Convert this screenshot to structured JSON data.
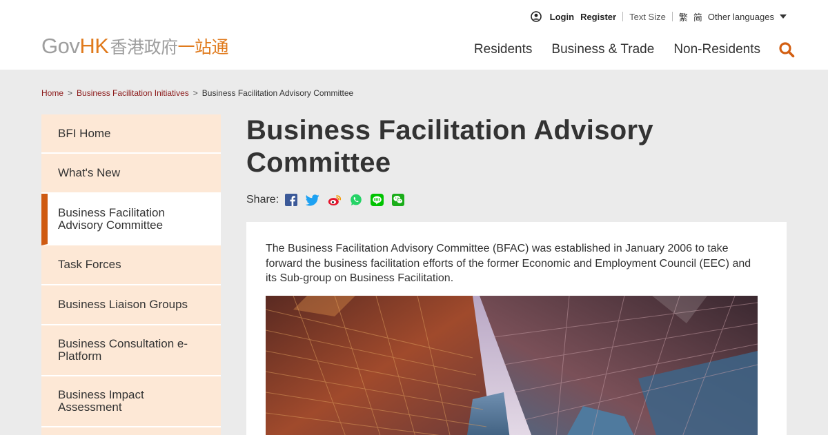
{
  "utility": {
    "login": "Login",
    "register": "Register",
    "text_size": "Text Size",
    "trad_chinese": "繁",
    "simp_chinese": "简",
    "other_languages": "Other languages"
  },
  "logo": {
    "gov": "Gov",
    "hk": "HK",
    "zh_grey": "香港政府",
    "zh_orange": "一站通"
  },
  "nav": {
    "items": [
      "Residents",
      "Business & Trade",
      "Non-Residents"
    ]
  },
  "breadcrumb": {
    "home": "Home",
    "section": "Business Facilitation Initiatives",
    "current": "Business Facilitation Advisory Committee",
    "separator": ">"
  },
  "sidebar": {
    "items": [
      {
        "label": "BFI Home"
      },
      {
        "label": "What's New"
      },
      {
        "label": "Business Facilitation Advisory Committee"
      },
      {
        "label": "Task Forces"
      },
      {
        "label": "Business Liaison Groups"
      },
      {
        "label": "Business Consultation e-Platform"
      },
      {
        "label": "Business Impact Assessment"
      }
    ]
  },
  "main": {
    "title": "Business Facilitation Advisory Committee",
    "share_label": "Share:",
    "intro": "The Business Facilitation Advisory Committee (BFAC) was established in January 2006 to take forward the business facilitation efforts of the former Economic and Employment Council (EEC) and its Sub-group on Business Facilitation."
  },
  "icons": {
    "user": "user-circle-icon",
    "search": "search-icon",
    "facebook": "facebook-icon",
    "twitter": "twitter-icon",
    "weibo": "weibo-icon",
    "whatsapp": "whatsapp-icon",
    "line": "line-icon",
    "wechat": "wechat-icon"
  },
  "colors": {
    "accent": "#e07a1c",
    "active_bar": "#cf5a11",
    "sidebar_bg": "#fde8d6",
    "breadcrumb_link": "#8b1a1a"
  }
}
